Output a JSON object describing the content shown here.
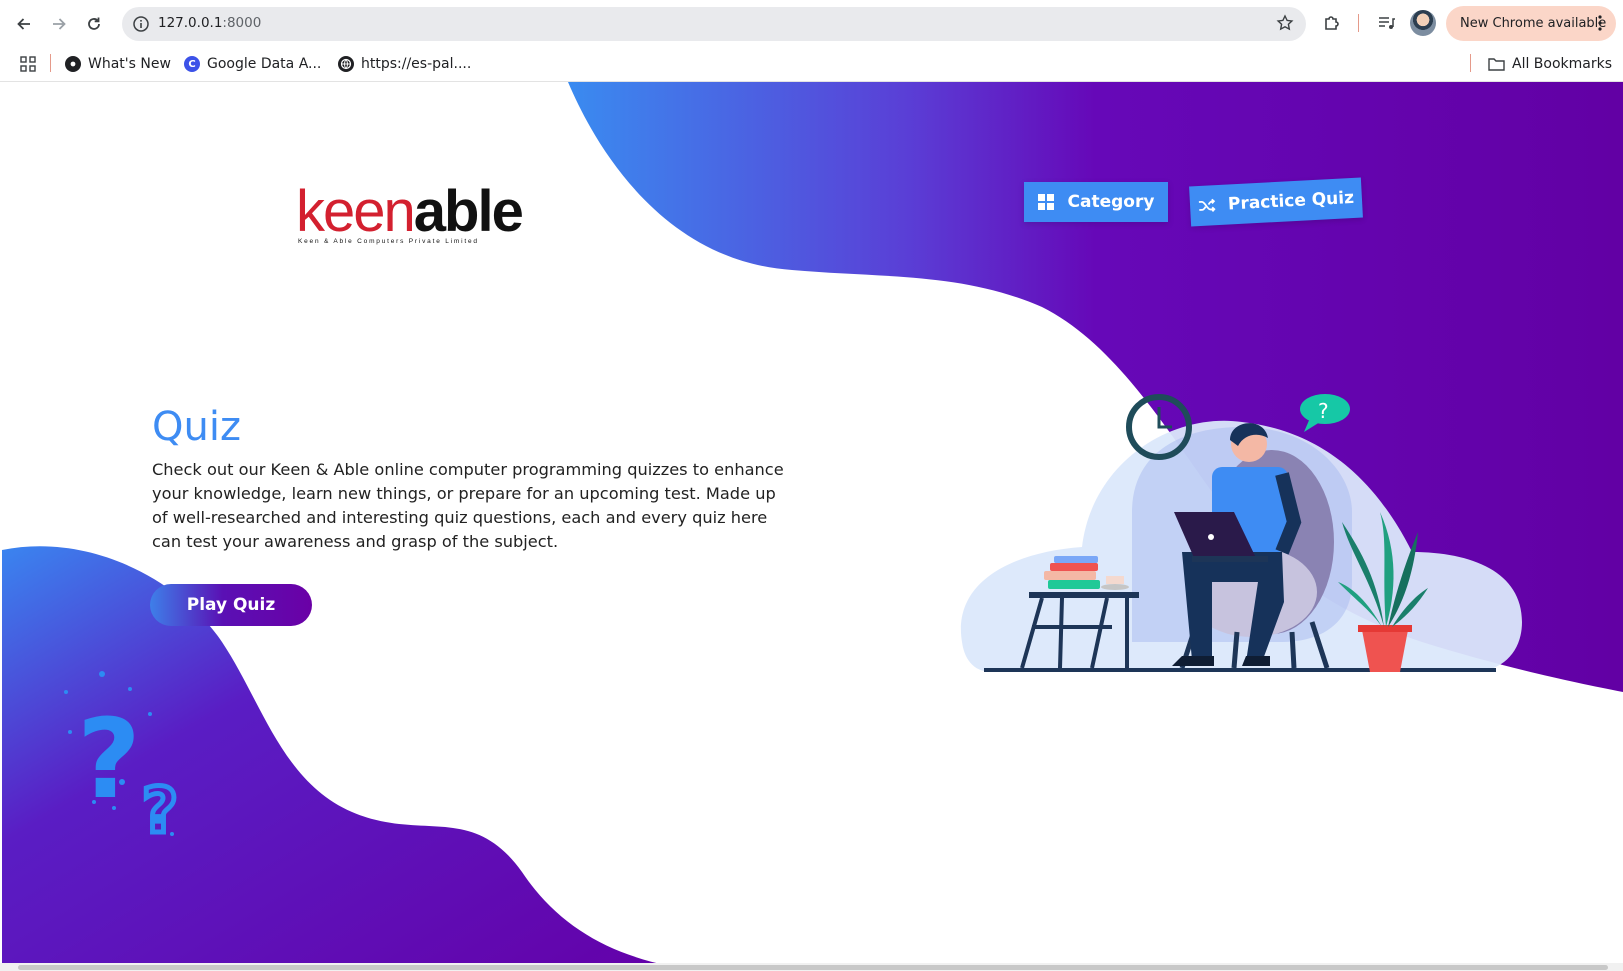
{
  "browser": {
    "url_host": "127.0.0.1",
    "url_port": ":8000",
    "update_button_label": "New Chrome available",
    "bookmarks": [
      {
        "label": "What's New"
      },
      {
        "label": "Google Data A..."
      },
      {
        "label": "https://es-pal...."
      }
    ],
    "all_bookmarks_label": "All Bookmarks"
  },
  "nav": {
    "category_label": "Category",
    "practice_label": "Practice Quiz"
  },
  "logo": {
    "keen": "keen",
    "able": "able",
    "tagline": "Keen & Able Computers Private Limited"
  },
  "hero": {
    "title": "Quiz",
    "description": "Check out our Keen & Able online computer programming quizzes to enhance your knowledge, learn new things, or prepare for an upcoming test. Made up of well-researched and interesting quiz questions, each and every quiz here can test your awareness and grasp of the subject.",
    "button_label": "Play Quiz",
    "bubble_text": "?"
  },
  "colors": {
    "accent_blue": "#3e8cf3",
    "purple": "#6200a8",
    "chrome_update_bg": "#fbd6c8"
  }
}
